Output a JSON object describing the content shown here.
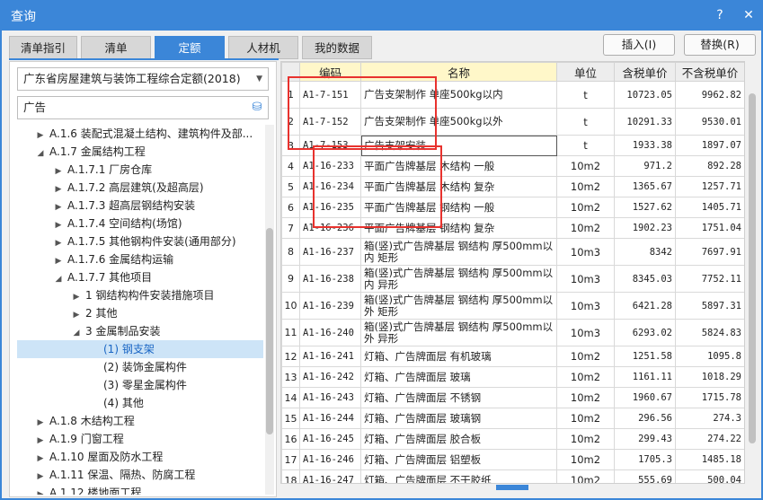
{
  "window": {
    "title": "查询",
    "help_glyph": "?",
    "close_glyph": "✕"
  },
  "tabs": [
    "清单指引",
    "清单",
    "定额",
    "人材机",
    "我的数据"
  ],
  "active_tab": 2,
  "buttons": {
    "insert": "插入(I)",
    "replace": "替换(R)"
  },
  "quota_library": {
    "selected": "广东省房屋建筑与装饰工程综合定额(2018)"
  },
  "search": {
    "value": "广告"
  },
  "tree": [
    {
      "label": "A.1.6 装配式混凝土结构、建筑构件及部...",
      "level": 1,
      "tri": "▶"
    },
    {
      "label": "A.1.7 金属结构工程",
      "level": 1,
      "tri": "◢"
    },
    {
      "label": "A.1.7.1 厂房仓库",
      "level": 2,
      "tri": "▶"
    },
    {
      "label": "A.1.7.2 高层建筑(及超高层)",
      "level": 2,
      "tri": "▶"
    },
    {
      "label": "A.1.7.3 超高层钢结构安装",
      "level": 2,
      "tri": "▶"
    },
    {
      "label": "A.1.7.4 空间结构(场馆)",
      "level": 2,
      "tri": "▶"
    },
    {
      "label": "A.1.7.5 其他钢构件安装(通用部分)",
      "level": 2,
      "tri": "▶"
    },
    {
      "label": "A.1.7.6 金属结构运输",
      "level": 2,
      "tri": "▶"
    },
    {
      "label": "A.1.7.7 其他项目",
      "level": 2,
      "tri": "◢"
    },
    {
      "label": "1 钢结构构件安装措施项目",
      "level": 3,
      "tri": "▶"
    },
    {
      "label": "2 其他",
      "level": 3,
      "tri": "▶"
    },
    {
      "label": "3 金属制品安装",
      "level": 3,
      "tri": "◢"
    },
    {
      "label": "(1) 钢支架",
      "level": 4,
      "tri": "",
      "selected": true
    },
    {
      "label": "(2) 装饰金属构件",
      "level": 4,
      "tri": ""
    },
    {
      "label": "(3) 零星金属构件",
      "level": 4,
      "tri": ""
    },
    {
      "label": "(4) 其他",
      "level": 4,
      "tri": ""
    },
    {
      "label": "A.1.8 木结构工程",
      "level": 1,
      "tri": "▶"
    },
    {
      "label": "A.1.9 门窗工程",
      "level": 1,
      "tri": "▶"
    },
    {
      "label": "A.1.10 屋面及防水工程",
      "level": 1,
      "tri": "▶"
    },
    {
      "label": "A.1.11 保温、隔热、防腐工程",
      "level": 1,
      "tri": "▶"
    },
    {
      "label": "A.1.12 楼地面工程",
      "level": 1,
      "tri": "▶"
    }
  ],
  "table": {
    "headers": [
      "",
      "编码",
      "名称",
      "单位",
      "含税单价",
      "不含税单价"
    ],
    "rows": [
      [
        "1",
        "A1-7-151",
        "广告支架制作 单座500kg以内",
        "t",
        "10723.05",
        "9962.82"
      ],
      [
        "2",
        "A1-7-152",
        "广告支架制作 单座500kg以外",
        "t",
        "10291.33",
        "9530.01"
      ],
      [
        "3",
        "A1-7-153",
        "广告支架安装",
        "t",
        "1933.38",
        "1897.07"
      ],
      [
        "4",
        "A1-16-233",
        "平面广告牌基层 木结构 一般",
        "10m2",
        "971.2",
        "892.28"
      ],
      [
        "5",
        "A1-16-234",
        "平面广告牌基层 木结构 复杂",
        "10m2",
        "1365.67",
        "1257.71"
      ],
      [
        "6",
        "A1-16-235",
        "平面广告牌基层 钢结构 一般",
        "10m2",
        "1527.62",
        "1405.71"
      ],
      [
        "7",
        "A1-16-236",
        "平面广告牌基层 钢结构 复杂",
        "10m2",
        "1902.23",
        "1751.04"
      ],
      [
        "8",
        "A1-16-237",
        "箱(竖)式广告牌基层 钢结构 厚500mm以内 矩形",
        "10m3",
        "8342",
        "7697.91"
      ],
      [
        "9",
        "A1-16-238",
        "箱(竖)式广告牌基层 钢结构 厚500mm以内 异形",
        "10m3",
        "8345.03",
        "7752.11"
      ],
      [
        "10",
        "A1-16-239",
        "箱(竖)式广告牌基层 钢结构 厚500mm以外 矩形",
        "10m3",
        "6421.28",
        "5897.31"
      ],
      [
        "11",
        "A1-16-240",
        "箱(竖)式广告牌基层 钢结构 厚500mm以外 异形",
        "10m3",
        "6293.02",
        "5824.83"
      ],
      [
        "12",
        "A1-16-241",
        "灯箱、广告牌面层 有机玻璃",
        "10m2",
        "1251.58",
        "1095.8"
      ],
      [
        "13",
        "A1-16-242",
        "灯箱、广告牌面层 玻璃",
        "10m2",
        "1161.11",
        "1018.29"
      ],
      [
        "14",
        "A1-16-243",
        "灯箱、广告牌面层 不锈钢",
        "10m2",
        "1960.67",
        "1715.78"
      ],
      [
        "15",
        "A1-16-244",
        "灯箱、广告牌面层 玻璃钢",
        "10m2",
        "296.56",
        "274.3"
      ],
      [
        "16",
        "A1-16-245",
        "灯箱、广告牌面层 胶合板",
        "10m2",
        "299.43",
        "274.22"
      ],
      [
        "17",
        "A1-16-246",
        "灯箱、广告牌面层 铝塑板",
        "10m2",
        "1705.3",
        "1485.18"
      ],
      [
        "18",
        "A1-16-247",
        "灯箱、广告牌面层 不干胶纸",
        "10m2",
        "555.69",
        "500.04"
      ]
    ],
    "current_row": 2,
    "highlight_header": 2
  },
  "colors": {
    "accent": "#3b86d8",
    "annotation_red": "#e8322e",
    "selection": "#cde4f7"
  }
}
